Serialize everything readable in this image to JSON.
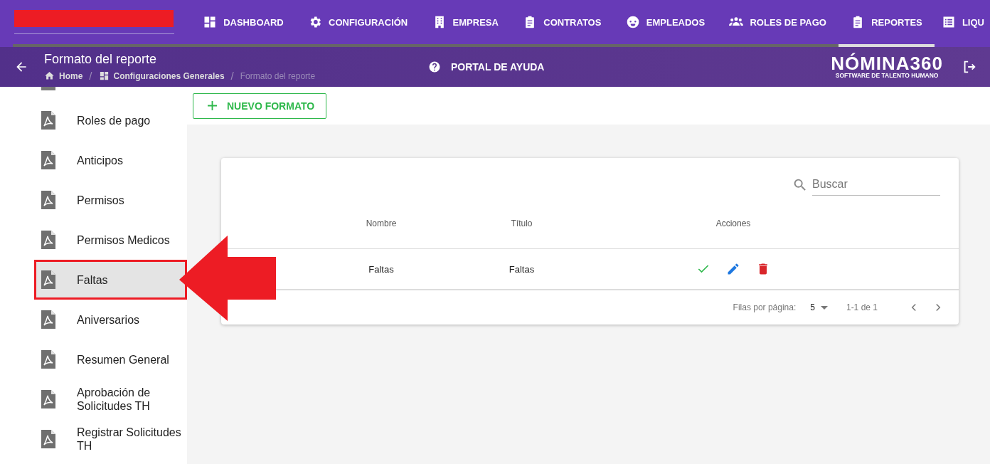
{
  "nav": [
    {
      "label": "DASHBOARD",
      "kind": "dashboard",
      "selected": false
    },
    {
      "label": "CONFIGURACIÓN",
      "kind": "settings",
      "selected": false
    },
    {
      "label": "EMPRESA",
      "kind": "company",
      "selected": false
    },
    {
      "label": "CONTRATOS",
      "kind": "contracts",
      "selected": false
    },
    {
      "label": "EMPLEADOS",
      "kind": "employees",
      "selected": false
    },
    {
      "label": "ROLES DE PAGO",
      "kind": "payroll",
      "selected": false
    },
    {
      "label": "REPORTES",
      "kind": "contracts",
      "selected": true
    },
    {
      "label": "LIQU",
      "kind": "list",
      "selected": false
    }
  ],
  "header": {
    "title": "Formato del reporte",
    "breadcrumbs": [
      {
        "label": "Home"
      },
      {
        "separator": "/",
        "label": "Configuraciones Generales"
      },
      {
        "separator": "/",
        "label": "Formato del reporte"
      }
    ],
    "help": "PORTAL DE AYUDA",
    "logo": "NÓMINA360",
    "logo_tagline": "SOFTWARE DE TALENTO HUMANO"
  },
  "sidebar": {
    "items": [
      {
        "label": "Roles de pago",
        "selected": false
      },
      {
        "label": "Anticipos",
        "selected": false
      },
      {
        "label": "Permisos",
        "selected": false
      },
      {
        "label": "Permisos Medicos",
        "selected": false
      },
      {
        "label": "Faltas",
        "selected": true
      },
      {
        "label": "Aniversarios",
        "selected": false
      },
      {
        "label": "Resumen General",
        "selected": false
      },
      {
        "label": "Aprobación de Solicitudes TH",
        "selected": false
      },
      {
        "label": "Registrar Solicitudes TH",
        "selected": false
      }
    ]
  },
  "new_button": "NUEVO FORMATO",
  "search": {
    "placeholder": "Buscar"
  },
  "table": {
    "columns": [
      "Nombre",
      "Título",
      "Acciones"
    ],
    "rows": [
      {
        "cells": [
          "Faltas",
          "Faltas"
        ]
      }
    ]
  },
  "pagination": {
    "rows_per_page_label": "Filas por página:",
    "rows_per_page": "5",
    "range": "1-1 de 1"
  }
}
